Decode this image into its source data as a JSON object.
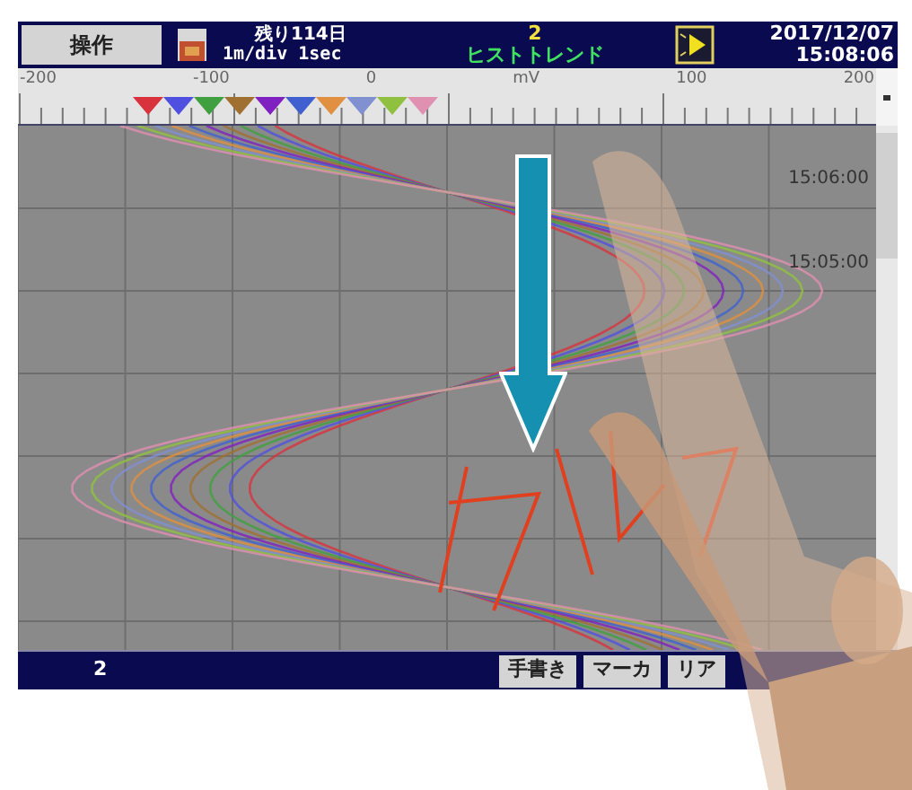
{
  "header": {
    "button": "操作",
    "remaining": "残り114日",
    "rate": "1m/div 1sec",
    "group_number": "2",
    "mode": "ヒストトレンド",
    "date": "2017/12/07",
    "time": "15:08:06"
  },
  "scale": {
    "labels": [
      "-200",
      "-100",
      "0",
      "mV",
      "100",
      "200"
    ]
  },
  "markers": [
    {
      "color": "#d8323c"
    },
    {
      "color": "#5050e0"
    },
    {
      "color": "#40a040"
    },
    {
      "color": "#a07030"
    },
    {
      "color": "#8020c0"
    },
    {
      "color": "#4060d0"
    },
    {
      "color": "#e09040"
    },
    {
      "color": "#8090d0"
    },
    {
      "color": "#90c040"
    },
    {
      "color": "#e090b0"
    }
  ],
  "time_labels": [
    "15:06:00",
    "15:05:00"
  ],
  "footer": {
    "group": "2",
    "buttons": [
      "手書き",
      "マーカ",
      "リア"
    ]
  }
}
